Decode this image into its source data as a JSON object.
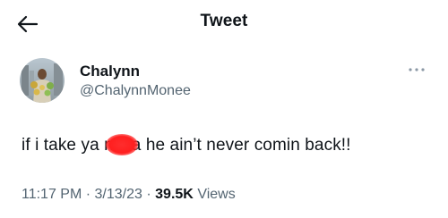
{
  "header": {
    "title": "Tweet",
    "back_icon": "arrow-left-icon"
  },
  "author": {
    "display_name": "Chalynn",
    "handle": "@ChalynnMonee",
    "avatar_icon": "profile-photo"
  },
  "more_icon": "more-horizontal-icon",
  "tweet": {
    "text_before": "if i take ya n",
    "redaction_mark": "red-scribble",
    "text_after": "a he ain’t never comin back!!"
  },
  "meta": {
    "time": "11:17 PM",
    "sep1": "·",
    "date": "3/13/23",
    "sep2": "·",
    "views_count": "39.5K",
    "views_label": "Views"
  },
  "colors": {
    "text_primary": "#0f1419",
    "text_secondary": "#536471",
    "redaction": "#ff1f1f"
  }
}
